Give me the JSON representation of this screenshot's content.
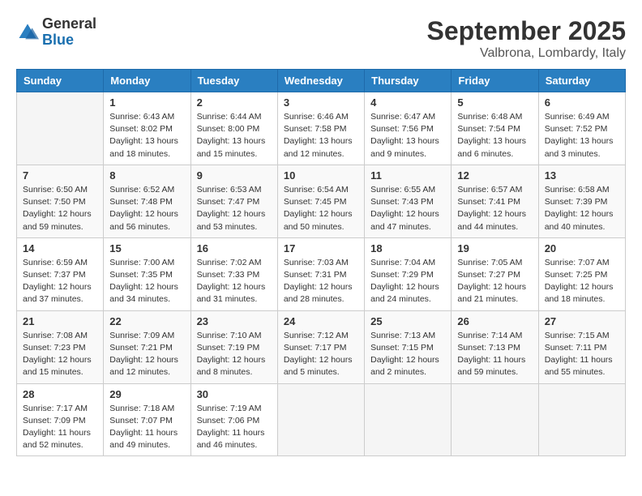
{
  "logo": {
    "general": "General",
    "blue": "Blue"
  },
  "title": "September 2025",
  "location": "Valbrona, Lombardy, Italy",
  "days_of_week": [
    "Sunday",
    "Monday",
    "Tuesday",
    "Wednesday",
    "Thursday",
    "Friday",
    "Saturday"
  ],
  "weeks": [
    [
      {
        "day": "",
        "info": ""
      },
      {
        "day": "1",
        "info": "Sunrise: 6:43 AM\nSunset: 8:02 PM\nDaylight: 13 hours\nand 18 minutes."
      },
      {
        "day": "2",
        "info": "Sunrise: 6:44 AM\nSunset: 8:00 PM\nDaylight: 13 hours\nand 15 minutes."
      },
      {
        "day": "3",
        "info": "Sunrise: 6:46 AM\nSunset: 7:58 PM\nDaylight: 13 hours\nand 12 minutes."
      },
      {
        "day": "4",
        "info": "Sunrise: 6:47 AM\nSunset: 7:56 PM\nDaylight: 13 hours\nand 9 minutes."
      },
      {
        "day": "5",
        "info": "Sunrise: 6:48 AM\nSunset: 7:54 PM\nDaylight: 13 hours\nand 6 minutes."
      },
      {
        "day": "6",
        "info": "Sunrise: 6:49 AM\nSunset: 7:52 PM\nDaylight: 13 hours\nand 3 minutes."
      }
    ],
    [
      {
        "day": "7",
        "info": "Sunrise: 6:50 AM\nSunset: 7:50 PM\nDaylight: 12 hours\nand 59 minutes."
      },
      {
        "day": "8",
        "info": "Sunrise: 6:52 AM\nSunset: 7:48 PM\nDaylight: 12 hours\nand 56 minutes."
      },
      {
        "day": "9",
        "info": "Sunrise: 6:53 AM\nSunset: 7:47 PM\nDaylight: 12 hours\nand 53 minutes."
      },
      {
        "day": "10",
        "info": "Sunrise: 6:54 AM\nSunset: 7:45 PM\nDaylight: 12 hours\nand 50 minutes."
      },
      {
        "day": "11",
        "info": "Sunrise: 6:55 AM\nSunset: 7:43 PM\nDaylight: 12 hours\nand 47 minutes."
      },
      {
        "day": "12",
        "info": "Sunrise: 6:57 AM\nSunset: 7:41 PM\nDaylight: 12 hours\nand 44 minutes."
      },
      {
        "day": "13",
        "info": "Sunrise: 6:58 AM\nSunset: 7:39 PM\nDaylight: 12 hours\nand 40 minutes."
      }
    ],
    [
      {
        "day": "14",
        "info": "Sunrise: 6:59 AM\nSunset: 7:37 PM\nDaylight: 12 hours\nand 37 minutes."
      },
      {
        "day": "15",
        "info": "Sunrise: 7:00 AM\nSunset: 7:35 PM\nDaylight: 12 hours\nand 34 minutes."
      },
      {
        "day": "16",
        "info": "Sunrise: 7:02 AM\nSunset: 7:33 PM\nDaylight: 12 hours\nand 31 minutes."
      },
      {
        "day": "17",
        "info": "Sunrise: 7:03 AM\nSunset: 7:31 PM\nDaylight: 12 hours\nand 28 minutes."
      },
      {
        "day": "18",
        "info": "Sunrise: 7:04 AM\nSunset: 7:29 PM\nDaylight: 12 hours\nand 24 minutes."
      },
      {
        "day": "19",
        "info": "Sunrise: 7:05 AM\nSunset: 7:27 PM\nDaylight: 12 hours\nand 21 minutes."
      },
      {
        "day": "20",
        "info": "Sunrise: 7:07 AM\nSunset: 7:25 PM\nDaylight: 12 hours\nand 18 minutes."
      }
    ],
    [
      {
        "day": "21",
        "info": "Sunrise: 7:08 AM\nSunset: 7:23 PM\nDaylight: 12 hours\nand 15 minutes."
      },
      {
        "day": "22",
        "info": "Sunrise: 7:09 AM\nSunset: 7:21 PM\nDaylight: 12 hours\nand 12 minutes."
      },
      {
        "day": "23",
        "info": "Sunrise: 7:10 AM\nSunset: 7:19 PM\nDaylight: 12 hours\nand 8 minutes."
      },
      {
        "day": "24",
        "info": "Sunrise: 7:12 AM\nSunset: 7:17 PM\nDaylight: 12 hours\nand 5 minutes."
      },
      {
        "day": "25",
        "info": "Sunrise: 7:13 AM\nSunset: 7:15 PM\nDaylight: 12 hours\nand 2 minutes."
      },
      {
        "day": "26",
        "info": "Sunrise: 7:14 AM\nSunset: 7:13 PM\nDaylight: 11 hours\nand 59 minutes."
      },
      {
        "day": "27",
        "info": "Sunrise: 7:15 AM\nSunset: 7:11 PM\nDaylight: 11 hours\nand 55 minutes."
      }
    ],
    [
      {
        "day": "28",
        "info": "Sunrise: 7:17 AM\nSunset: 7:09 PM\nDaylight: 11 hours\nand 52 minutes."
      },
      {
        "day": "29",
        "info": "Sunrise: 7:18 AM\nSunset: 7:07 PM\nDaylight: 11 hours\nand 49 minutes."
      },
      {
        "day": "30",
        "info": "Sunrise: 7:19 AM\nSunset: 7:06 PM\nDaylight: 11 hours\nand 46 minutes."
      },
      {
        "day": "",
        "info": ""
      },
      {
        "day": "",
        "info": ""
      },
      {
        "day": "",
        "info": ""
      },
      {
        "day": "",
        "info": ""
      }
    ]
  ]
}
